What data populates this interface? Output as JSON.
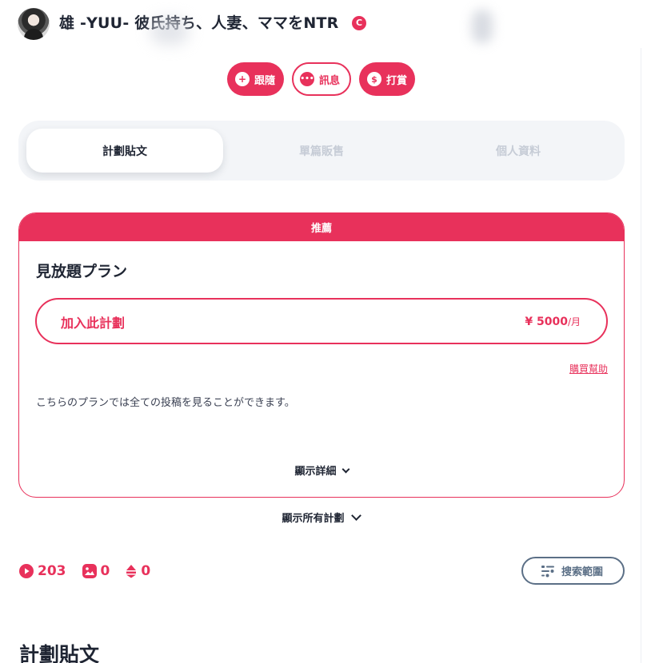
{
  "header": {
    "creator_name": "雄 -YUU- 彼氏持ち、人妻、ママをNTR",
    "verified_glyph": "C"
  },
  "actions": {
    "follow_label": "跟隨",
    "message_label": "訊息",
    "tip_label": "打賞"
  },
  "tabs": [
    {
      "label": "計劃貼文",
      "active": true
    },
    {
      "label": "單篇販售",
      "active": false
    },
    {
      "label": "個人資料",
      "active": false
    }
  ],
  "plan": {
    "ribbon": "推薦",
    "title": "見放題プラン",
    "join_label": "加入此計劃",
    "price": "¥ 5000",
    "price_unit": "/月",
    "help_link": "購買幫助",
    "description": "こちらのプランでは全ての投稿を見ることができます。",
    "show_detail": "顯示詳細"
  },
  "show_all_plans": "顯示所有計劃",
  "stats": {
    "videos": "203",
    "images": "0",
    "audio": "0"
  },
  "search_scope_label": "搜索範圍",
  "section_title": "計劃貼文",
  "colors": {
    "accent": "#e8315b",
    "text": "#1f2533",
    "muted_tab": "#c6ccd6",
    "scope_button": "#5b6f86"
  },
  "icons": [
    "plus-icon",
    "chat-bubble-icon",
    "coins-icon",
    "play-icon",
    "image-icon",
    "audio-icon",
    "filter-icon",
    "chevron-down-icon"
  ]
}
